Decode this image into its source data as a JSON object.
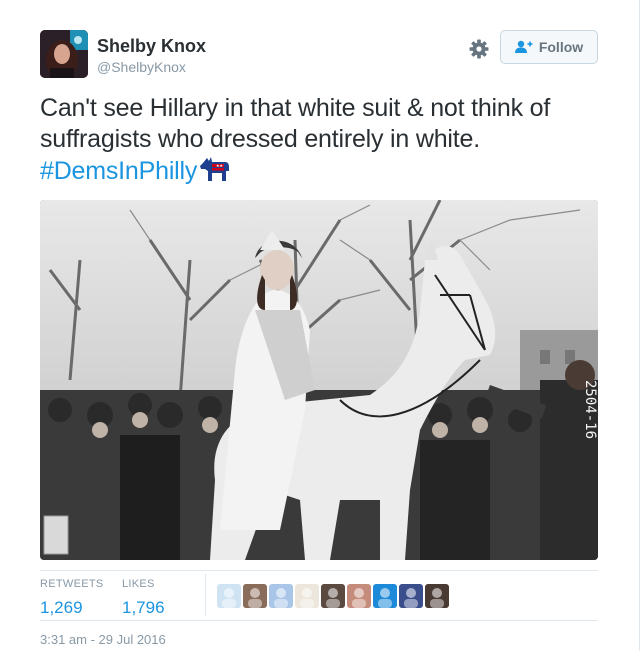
{
  "user": {
    "name": "Shelby Knox",
    "handle": "@ShelbyKnox"
  },
  "actions": {
    "follow_label": "Follow",
    "settings_icon": "gear-icon"
  },
  "tweet": {
    "line1": "Can't see Hillary in that white suit & not think of",
    "line2": "suffragists who dressed entirely in white.",
    "hashtag": "#DemsInPhilly",
    "hashtag_emoji": "democrat-donkey-icon"
  },
  "photo": {
    "stamp_text": "2504-16"
  },
  "stats": {
    "retweets_label": "RETWEETS",
    "retweets_value": "1,269",
    "likes_label": "LIKES",
    "likes_value": "1,796"
  },
  "likers": [
    {
      "color": "#cfe3f2"
    },
    {
      "color": "#8a6c5a"
    },
    {
      "color": "#a9c6e8"
    },
    {
      "color": "#ece6dc"
    },
    {
      "color": "#5a4a40"
    },
    {
      "color": "#c58b7b"
    },
    {
      "color": "#1d8ad9"
    },
    {
      "color": "#3a4e8c"
    },
    {
      "color": "#4a3a34"
    }
  ],
  "timestamp": "3:31 am - 29 Jul 2016",
  "colors": {
    "link": "#1b95e0",
    "muted": "#8899a6",
    "text": "#292f33"
  }
}
